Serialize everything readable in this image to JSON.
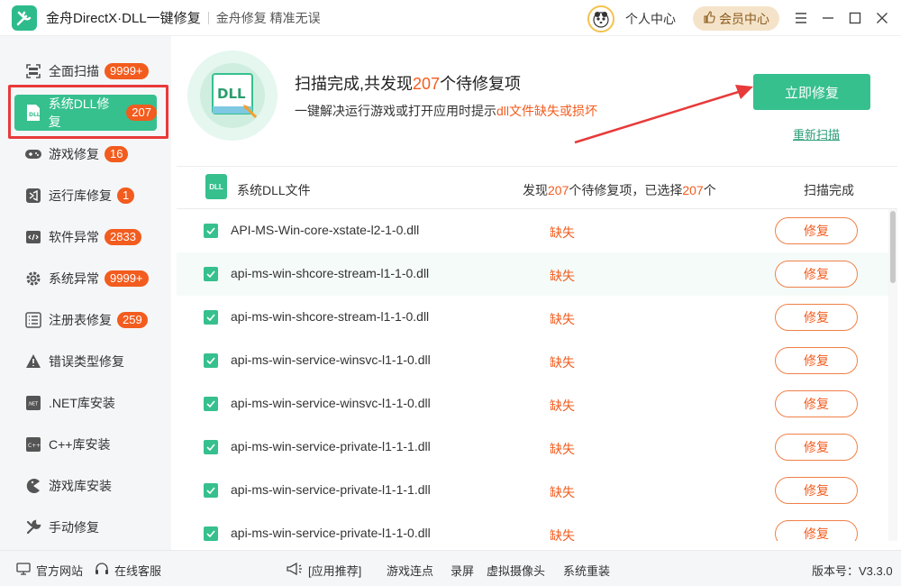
{
  "app": {
    "title": "金舟DirectX·DLL一键修复",
    "slogan": "金舟修复 精准无误",
    "user_center": "个人中心",
    "vip_label": "会员中心",
    "accent": "#36c08e",
    "warning": "#f25c1e"
  },
  "sidebar": {
    "items": [
      {
        "label": "全面扫描",
        "badge": "9999+",
        "icon": "scan-icon"
      },
      {
        "label": "系统DLL修复",
        "badge": "207",
        "icon": "dll-icon"
      },
      {
        "label": "游戏修复",
        "badge": "16",
        "icon": "gamepad-icon"
      },
      {
        "label": "运行库修复",
        "badge": "1",
        "icon": "visual-studio-icon"
      },
      {
        "label": "软件异常",
        "badge": "2833",
        "icon": "code-window-icon"
      },
      {
        "label": "系统异常",
        "badge": "9999+",
        "icon": "gear-icon"
      },
      {
        "label": "注册表修复",
        "badge": "259",
        "icon": "list-icon"
      },
      {
        "label": "错误类型修复",
        "badge": "",
        "icon": "warning-icon"
      },
      {
        "label": ".NET库安装",
        "badge": "",
        "icon": "dotnet-icon"
      },
      {
        "label": "C++库安装",
        "badge": "",
        "icon": "cpp-icon"
      },
      {
        "label": "游戏库安装",
        "badge": "",
        "icon": "pacman-icon"
      },
      {
        "label": "手动修复",
        "badge": "",
        "icon": "wrench-icon"
      }
    ]
  },
  "header": {
    "title_prefix": "扫描完成,共发现",
    "title_count": "207",
    "title_suffix": "个待修复项",
    "subtitle_prefix": "一键解决运行游戏或打开应用时提示",
    "subtitle_highlight": "dll文件缺失或损坏",
    "fix_now": "立即修复",
    "rescan": "重新扫描",
    "hero_label": "DLL"
  },
  "table": {
    "column_name": "系统DLL文件",
    "summary_prefix": "发现",
    "summary_found": "207",
    "summary_middle": "个待修复项，已选择",
    "summary_selected": "207",
    "summary_suffix": "个",
    "status": "扫描完成",
    "icon_label": "DLL",
    "rows": [
      {
        "file": "API-MS-Win-core-xstate-l2-1-0.dll",
        "state": "缺失",
        "action": "修复"
      },
      {
        "file": "api-ms-win-shcore-stream-l1-1-0.dll",
        "state": "缺失",
        "action": "修复"
      },
      {
        "file": "api-ms-win-shcore-stream-l1-1-0.dll",
        "state": "缺失",
        "action": "修复"
      },
      {
        "file": "api-ms-win-service-winsvc-l1-1-0.dll",
        "state": "缺失",
        "action": "修复"
      },
      {
        "file": "api-ms-win-service-winsvc-l1-1-0.dll",
        "state": "缺失",
        "action": "修复"
      },
      {
        "file": "api-ms-win-service-private-l1-1-1.dll",
        "state": "缺失",
        "action": "修复"
      },
      {
        "file": "api-ms-win-service-private-l1-1-1.dll",
        "state": "缺失",
        "action": "修复"
      },
      {
        "file": "api-ms-win-service-private-l1-1-0.dll",
        "state": "缺失",
        "action": "修复"
      }
    ]
  },
  "footer": {
    "website": "官方网站",
    "service": "在线客服",
    "recommend": "[应用推荐]",
    "links": [
      "游戏连点",
      "录屏",
      "虚拟摄像头",
      "系统重装"
    ],
    "version": "版本号：V3.3.0"
  }
}
